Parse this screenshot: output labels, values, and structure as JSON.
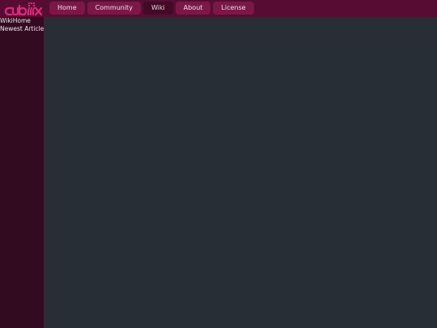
{
  "header": {
    "logo_text": "cubix",
    "nav": [
      {
        "label": "Home",
        "active": false
      },
      {
        "label": "Community",
        "active": false
      },
      {
        "label": "Wiki",
        "active": true
      },
      {
        "label": "About",
        "active": false
      },
      {
        "label": "License",
        "active": false
      }
    ]
  },
  "sidebar": {
    "items": [
      {
        "label": "WikiHome"
      },
      {
        "label": "Newest Article"
      }
    ]
  },
  "colors": {
    "topbar": "#570d33",
    "tab": "#7b1848",
    "tab_active": "#420a27",
    "sidebar": "#330b21",
    "content": "#272e35",
    "logo": "#e0287a"
  }
}
